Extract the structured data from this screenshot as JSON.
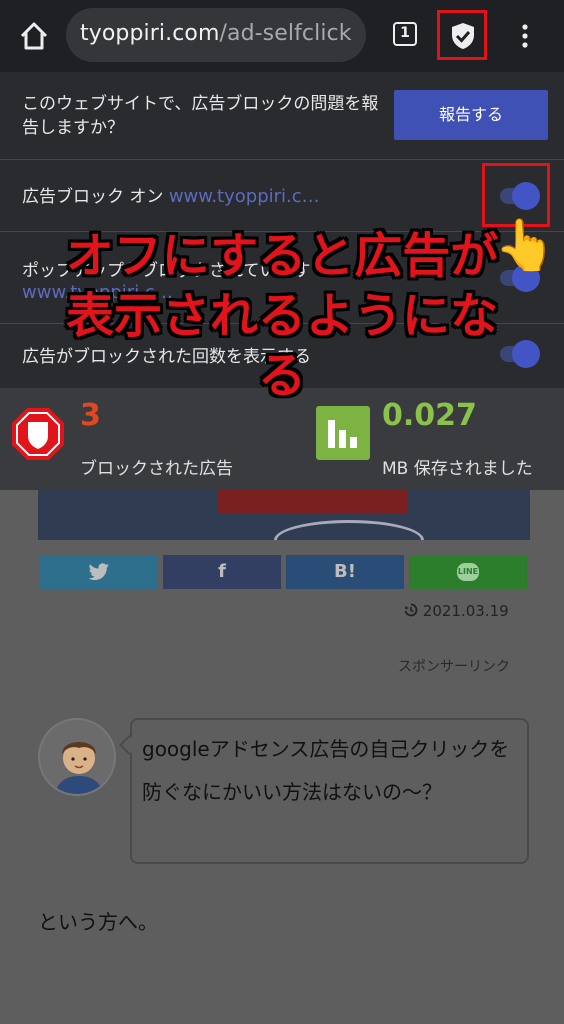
{
  "browser": {
    "url_domain": "tyoppiri.com",
    "url_path": "/ad-selfclick",
    "tab_count": "1",
    "icons": [
      "home-icon",
      "shield-check-icon",
      "more-vert-icon"
    ]
  },
  "panel": {
    "report_question": "このウェブサイトで、広告ブロックの問題を報告しますか？",
    "report_button": "報告する",
    "rows": [
      {
        "label": "広告ブロック オン",
        "site": "www.tyoppiri.c…",
        "enabled": true
      },
      {
        "label": "ポップアップがブロックされています",
        "site": "www.tyoppiri.c…",
        "enabled": true
      },
      {
        "label": "広告がブロックされた回数を表示する",
        "enabled": true
      }
    ]
  },
  "stats": {
    "blocked_count": "3",
    "blocked_label": "ブロックされた広告",
    "saved_value": "0.027",
    "saved_label": "MB 保存されました"
  },
  "article": {
    "share_buttons": [
      "twitter",
      "f",
      "B!",
      "LINE"
    ],
    "date": "2021.03.19",
    "sponsor_label": "スポンサーリンク",
    "speech_bubble": "googleアドセンス広告の自己クリックを防ぐなにかいい方法はないの～？",
    "body_text": "という方へ。"
  },
  "annotation": {
    "caption": "オフにすると広告が表示されるようになる"
  },
  "colors": {
    "accent": "#3f51b5",
    "annotation_red": "#e0131a",
    "blocked_count": "#e34722",
    "saved_value": "#8bc34a"
  }
}
